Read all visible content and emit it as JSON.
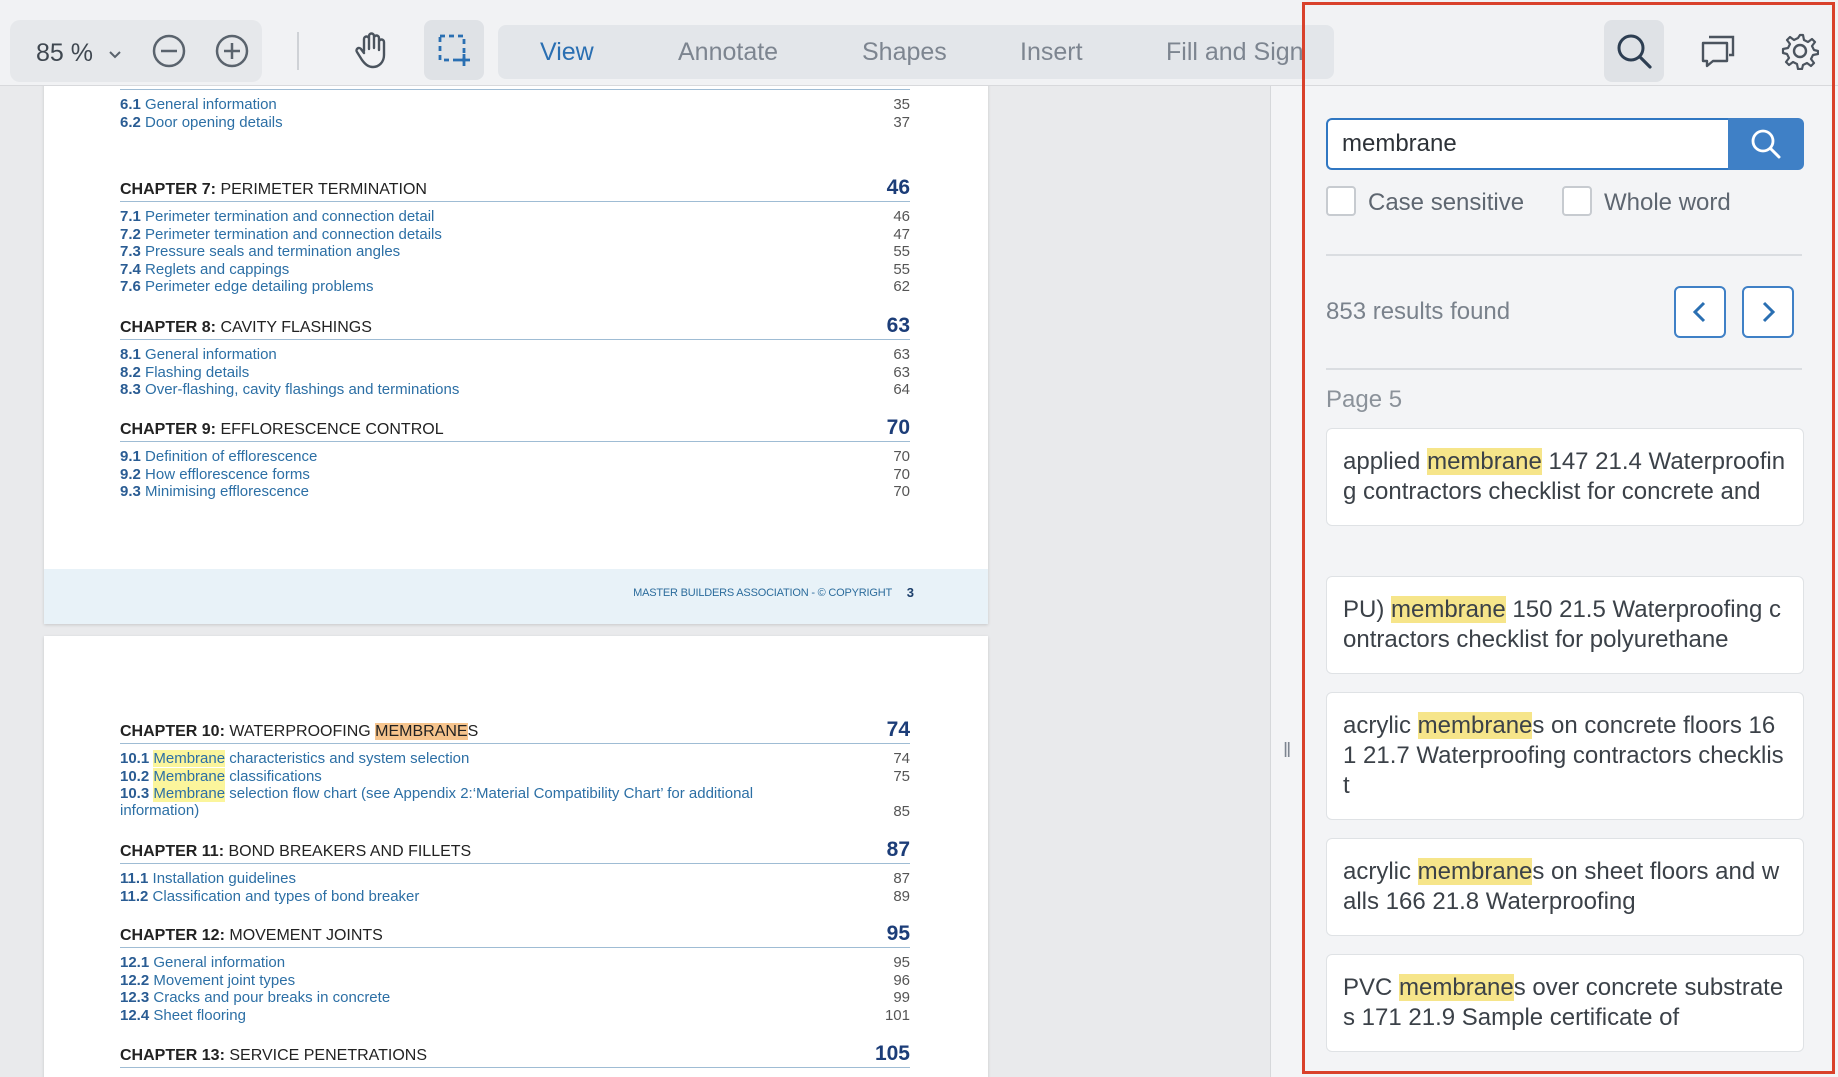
{
  "toolbar": {
    "zoom": "85 %",
    "tabs": [
      "View",
      "Annotate",
      "Shapes",
      "Insert",
      "Fill and Sign"
    ],
    "active_tab": "View"
  },
  "page1": {
    "partial_entries": [
      {
        "num": "6.1",
        "text": "General information",
        "page": "35"
      },
      {
        "num": "6.2",
        "text": "Door opening details",
        "page": "37"
      }
    ],
    "chapters": [
      {
        "label": "CHAPTER 7:",
        "title": "PERIMETER TERMINATION",
        "page": "46",
        "entries": [
          {
            "num": "7.1",
            "text": "Perimeter termination and connection detail",
            "page": "46"
          },
          {
            "num": "7.2",
            "text": "Perimeter termination and connection details",
            "page": "47"
          },
          {
            "num": "7.3",
            "text": "Pressure seals and termination angles",
            "page": "55"
          },
          {
            "num": "7.4",
            "text": "Reglets and cappings",
            "page": "55"
          },
          {
            "num": "7.6",
            "text": "Perimeter edge detailing problems",
            "page": "62"
          }
        ]
      },
      {
        "label": "CHAPTER 8:",
        "title": "CAVITY FLASHINGS",
        "page": "63",
        "entries": [
          {
            "num": "8.1",
            "text": "General information",
            "page": "63"
          },
          {
            "num": "8.2",
            "text": "Flashing details",
            "page": "63"
          },
          {
            "num": "8.3",
            "text": "Over-flashing, cavity flashings and terminations",
            "page": "64"
          }
        ]
      },
      {
        "label": "CHAPTER 9:",
        "title": "EFFLORESCENCE CONTROL",
        "page": "70",
        "entries": [
          {
            "num": "9.1",
            "text": "Definition of efflorescence",
            "page": "70"
          },
          {
            "num": "9.2",
            "text": "How efflorescence forms",
            "page": "70"
          },
          {
            "num": "9.3",
            "text": "Minimising efflorescence",
            "page": "70"
          }
        ]
      }
    ],
    "footer": "MASTER BUILDERS ASSOCIATION - © COPYRIGHT",
    "footer_page": "3"
  },
  "page2": {
    "ch10": {
      "label": "CHAPTER 10:",
      "title_pre": "WATERPROOFING ",
      "title_hl": "MEMBRANE",
      "title_post": "S",
      "page": "74",
      "entries": [
        {
          "num": "10.1",
          "hl": "Membrane",
          "text": " characteristics and system selection",
          "page": "74"
        },
        {
          "num": "10.2",
          "hl": "Membrane",
          "text": " classifications",
          "page": "75"
        },
        {
          "num": "10.3",
          "hl": "Membrane",
          "text": " selection flow chart (see Appendix 2:‘Material Compatibility Chart’ for additional",
          "text2": "information)",
          "page": "85"
        }
      ]
    },
    "chapters": [
      {
        "label": "CHAPTER 11:",
        "title": "BOND BREAKERS AND FILLETS",
        "page": "87",
        "entries": [
          {
            "num": "11.1",
            "text": "Installation guidelines",
            "page": "87"
          },
          {
            "num": "11.2",
            "text": "Classification and types of bond breaker",
            "page": "89"
          }
        ]
      },
      {
        "label": "CHAPTER 12:",
        "title": "MOVEMENT JOINTS",
        "page": "95",
        "entries": [
          {
            "num": "12.1",
            "text": "General information",
            "page": "95"
          },
          {
            "num": "12.2",
            "text": "Movement joint types",
            "page": "96"
          },
          {
            "num": "12.3",
            "text": "Cracks and pour breaks in concrete",
            "page": "99"
          },
          {
            "num": "12.4",
            "text": "Sheet flooring",
            "page": "101"
          }
        ]
      },
      {
        "label": "CHAPTER 13:",
        "title": "SERVICE PENETRATIONS",
        "page": "105",
        "entries": []
      }
    ]
  },
  "search": {
    "query": "membrane",
    "case_sensitive_label": "Case sensitive",
    "whole_word_label": "Whole word",
    "results_count": "853 results found",
    "page_label": "Page 5",
    "results": [
      {
        "pre": "applied ",
        "hl": "membrane",
        "post": " 147 21.4 Waterproofing contractors checklist for concrete and"
      },
      {
        "pre": "PU) ",
        "hl": "membrane",
        "post": " 150 21.5 Waterproofing contractors checklist for polyurethane"
      },
      {
        "pre": "acrylic ",
        "hl": "membrane",
        "post": "s on concrete floors 161 21.7 Waterproofing contractors checklist"
      },
      {
        "pre": "acrylic ",
        "hl": "membrane",
        "post": "s on sheet floors and walls 166 21.8 Waterproofing"
      },
      {
        "pre": "PVC ",
        "hl": "membrane",
        "post": "s over concrete substrates 171 21.9 Sample certificate of"
      }
    ]
  },
  "colors": {
    "accent": "#3f80c6",
    "highlight": "#f6e58a",
    "frame": "#d9412b"
  }
}
